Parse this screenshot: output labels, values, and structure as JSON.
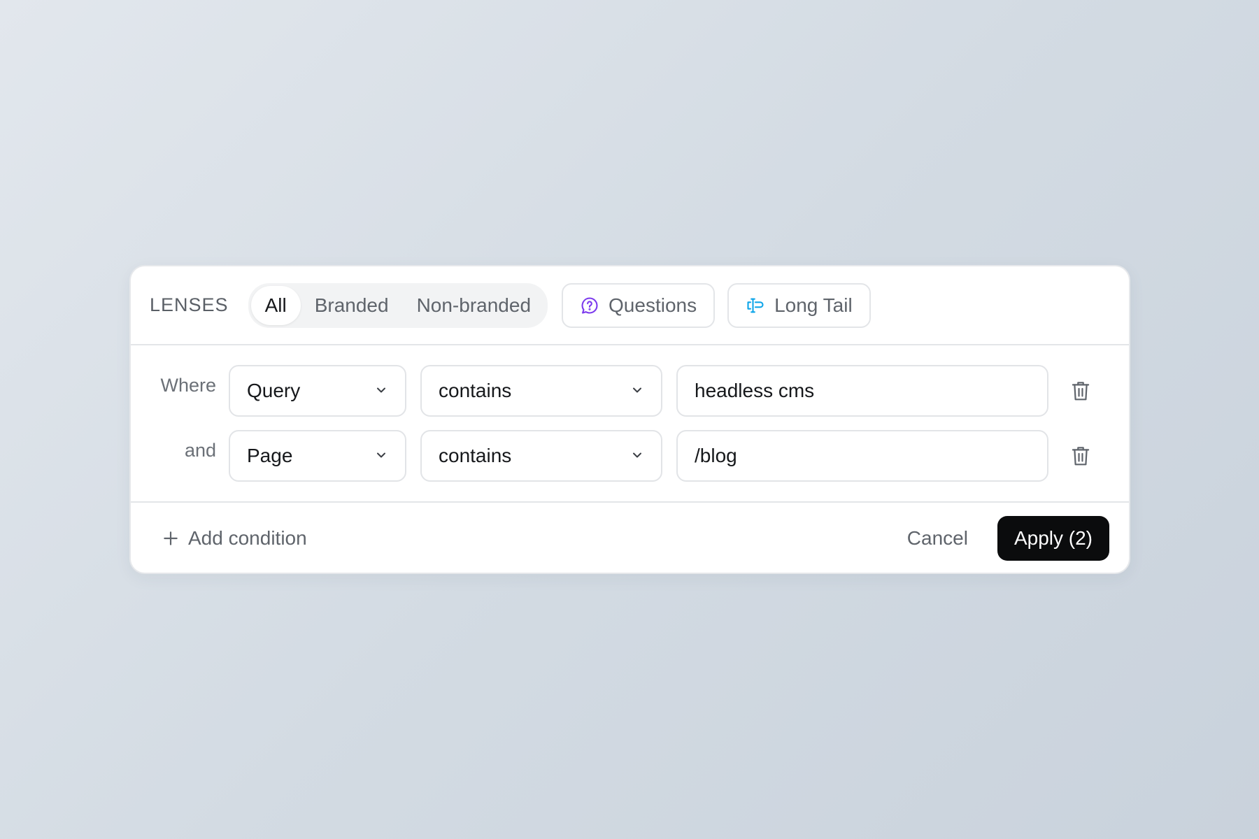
{
  "header": {
    "lenses_label": "LENSES",
    "segments": [
      {
        "label": "All",
        "active": true
      },
      {
        "label": "Branded",
        "active": false
      },
      {
        "label": "Non-branded",
        "active": false
      }
    ],
    "chips": [
      {
        "label": "Questions",
        "icon": "question-bubble-icon",
        "icon_color": "#7c3aed"
      },
      {
        "label": "Long Tail",
        "icon": "long-tail-icon",
        "icon_color": "#0ea5e9"
      }
    ]
  },
  "conditions": [
    {
      "connector": "Where",
      "field": "Query",
      "operator": "contains",
      "value": "headless cms"
    },
    {
      "connector": "and",
      "field": "Page",
      "operator": "contains",
      "value": "/blog"
    }
  ],
  "footer": {
    "add_label": "Add condition",
    "cancel_label": "Cancel",
    "apply_label": "Apply (2)"
  },
  "colors": {
    "apply_bg": "#0b0c0d",
    "text_primary": "#16181b",
    "text_muted": "#5f646b"
  }
}
